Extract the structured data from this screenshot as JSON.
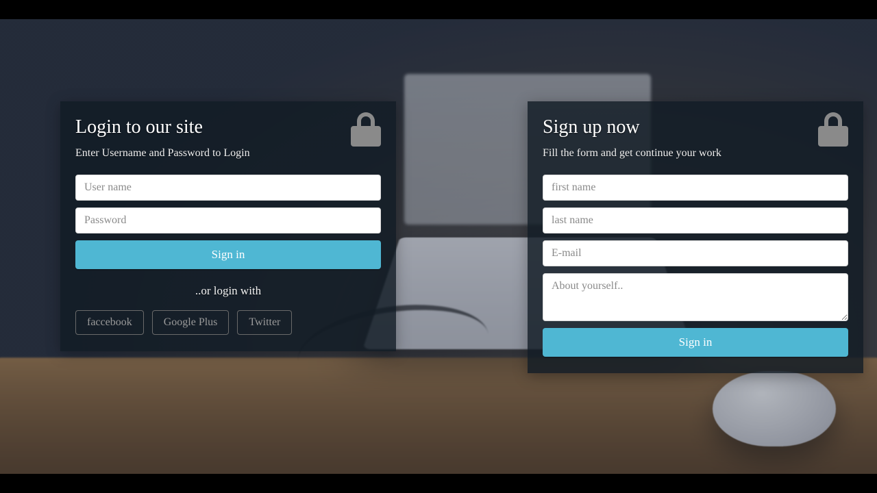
{
  "login": {
    "title": "Login to our site",
    "subtitle": "Enter Username and Password to Login",
    "username_placeholder": "User name",
    "password_placeholder": "Password",
    "submit_label": "Sign in",
    "divider_text": "..or login with",
    "social": {
      "facebook": "faccebook",
      "google": "Google Plus",
      "twitter": "Twitter"
    }
  },
  "signup": {
    "title": "Sign up now",
    "subtitle": "Fill the form and get continue your work",
    "firstname_placeholder": "first name",
    "lastname_placeholder": "last name",
    "email_placeholder": "E-mail",
    "about_placeholder": "About yourself..",
    "submit_label": "Sign in"
  },
  "colors": {
    "primary": "#4fb7d3",
    "card_bg": "rgba(18,28,38,0.82)"
  }
}
